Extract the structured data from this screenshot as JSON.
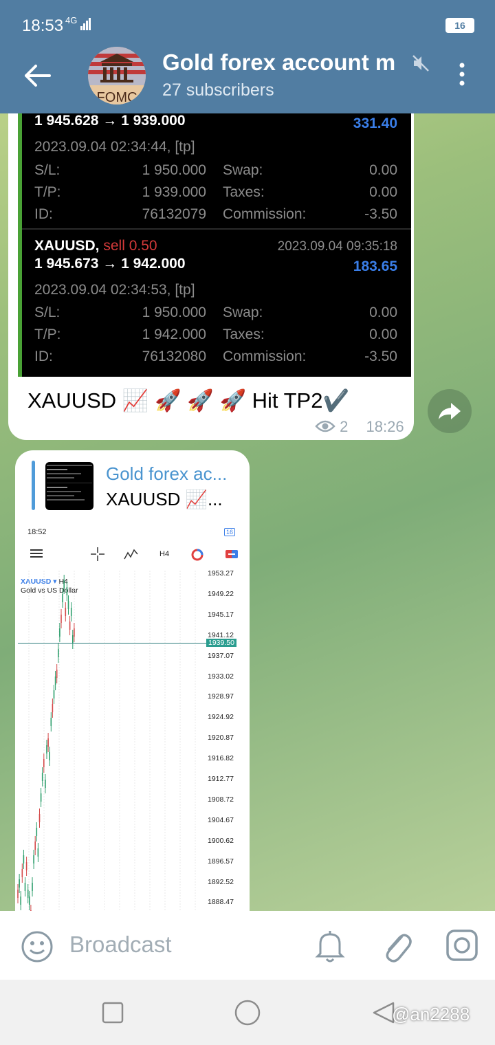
{
  "status": {
    "time": "18:53",
    "network": "4G",
    "battery": "16"
  },
  "header": {
    "title": "Gold forex account m",
    "subtitle": "27 subscribers",
    "avatar_text": "FOMC"
  },
  "message1": {
    "trade1": {
      "price_range": "1 945.628 → 1 939.000",
      "profit": "331.40",
      "open_time": "2023.09.04 02:34:44, [tp]",
      "sl_label": "S/L:",
      "sl": "1 950.000",
      "swap_label": "Swap:",
      "swap": "0.00",
      "tp_label": "T/P:",
      "tp": "1 939.000",
      "taxes_label": "Taxes:",
      "taxes": "0.00",
      "id_label": "ID:",
      "id": "76132079",
      "commission_label": "Commission:",
      "commission": "-3.50"
    },
    "trade2": {
      "symbol": "XAUUSD,",
      "action": "sell 0.50",
      "close_time": "2023.09.04 09:35:18",
      "price_range": "1 945.673 → 1 942.000",
      "profit": "183.65",
      "open_time": "2023.09.04 02:34:53, [tp]",
      "sl_label": "S/L:",
      "sl": "1 950.000",
      "swap_label": "Swap:",
      "swap": "0.00",
      "tp_label": "T/P:",
      "tp": "1 942.000",
      "taxes_label": "Taxes:",
      "taxes": "0.00",
      "id_label": "ID:",
      "id": "76132080",
      "commission_label": "Commission:",
      "commission": "-3.50"
    },
    "text": "XAUUSD 📈 🚀 🚀 🚀 Hit TP2✔️",
    "views": "2",
    "time": "18:26"
  },
  "message2": {
    "reply_name": "Gold forex ac...",
    "reply_text": "XAUUSD 📈...",
    "chart": {
      "status_time": "18:52",
      "battery": "16",
      "timeframe": "H4",
      "symbol": "XAUUSD",
      "symbol_tf": "H4",
      "description": "Gold vs US Dollar",
      "current_price": "1939.50",
      "price_levels": [
        "1953.27",
        "1949.22",
        "1945.17",
        "1941.12",
        "1937.07",
        "1933.02",
        "1928.97",
        "1924.92",
        "1920.87",
        "1916.82",
        "1912.77",
        "1908.72",
        "1904.67",
        "1900.62",
        "1896.57",
        "1892.52",
        "1888.47"
      ]
    }
  },
  "input": {
    "placeholder": "Broadcast"
  },
  "watermark": "@an2288",
  "colors": {
    "header": "#517da2",
    "accent_blue": "#4a94cf",
    "profit_blue": "#3a7ee8",
    "sell_red": "#d43a3a"
  }
}
